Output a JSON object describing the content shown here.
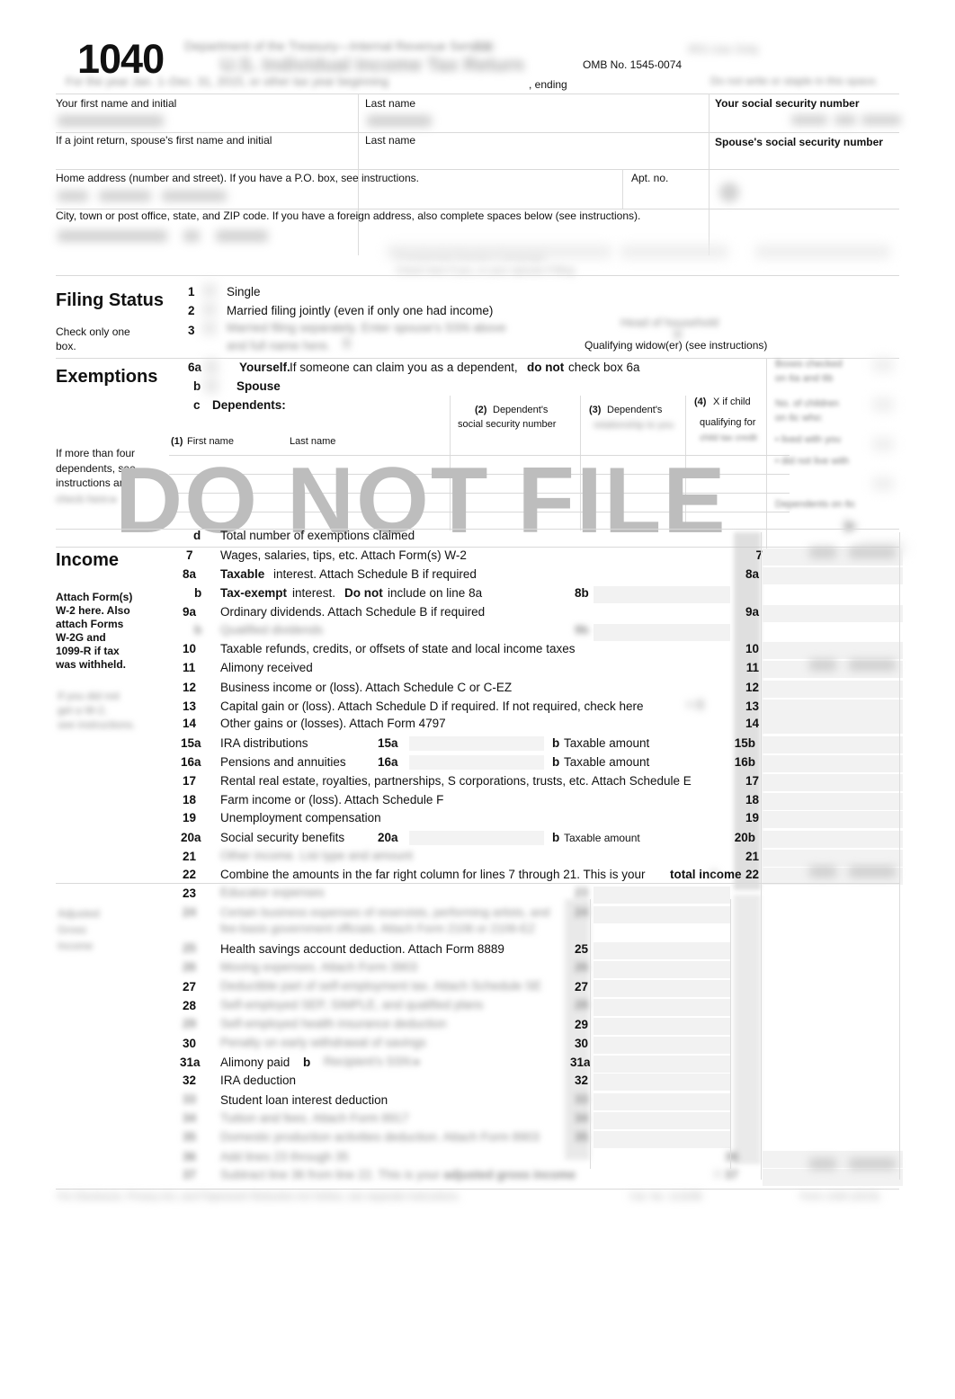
{
  "document": {
    "form_number": "1040",
    "omb": "OMB No. 1545-0074",
    "ending_label": ", ending",
    "watermark": "DO NOT FILE"
  },
  "name_block": {
    "your_first_name": "Your first name and initial",
    "last_name": "Last name",
    "joint_spouse_name": "If a joint return, spouse's first name and initial",
    "spouse_last_name": "Last name",
    "your_ssn": "Your social security number",
    "spouse_ssn": "Spouse's social security number",
    "home_address": "Home address (number and street). If you have a P.O. box, see instructions.",
    "apt_no": "Apt. no.",
    "city_state_zip": "City, town or post office, state, and ZIP code. If you have a foreign address, also complete spaces below (see instructions)."
  },
  "filing_status": {
    "heading": "Filing Status",
    "subtext_line1": "Check only one",
    "subtext_line2": "box.",
    "options": [
      {
        "num": "1",
        "label": "Single"
      },
      {
        "num": "2",
        "label": "Married filing jointly (even if only one had income)"
      },
      {
        "num": "3",
        "label": ""
      }
    ],
    "qualifying_widow": "Qualifying widow(er) (see instructions)"
  },
  "exemptions": {
    "heading": "Exemptions",
    "line_6a_num": "6a",
    "line_6a_bold": "Yourself.",
    "line_6a_text_1": "If someone can claim you as a dependent,",
    "line_6a_bold_2": "do not",
    "line_6a_text_2": "check box 6a",
    "line_b_num": "b",
    "line_b_label": "Spouse",
    "line_c_num": "c",
    "line_c_label": "Dependents:",
    "col1_num": "(1)",
    "col1_first": "First name",
    "col1_last": "Last name",
    "col2_num": "(2)",
    "col2_line1": "Dependent's",
    "col2_line2": "social security number",
    "col3_num": "(3)",
    "col3_line1": "Dependent's",
    "col4_num": "(4)",
    "col4_line1": "X if child",
    "col4_line2": "qualifying for",
    "sidebar_line1": "If more than four",
    "sidebar_line2": "dependents, see",
    "sidebar_line3": "instructions and",
    "line_d_num": "d",
    "line_d_label": "Total number of exemptions claimed"
  },
  "income": {
    "heading": "Income",
    "attach_line1": "Attach Form(s)",
    "attach_line2": "W-2 here. Also",
    "attach_line3": "attach Forms",
    "attach_line4": "W-2G and",
    "attach_line5": "1099-R if tax",
    "attach_line6": "was withheld.",
    "lines": [
      {
        "num": "7",
        "text": "Wages, salaries, tips, etc. Attach Form(s) W-2",
        "amt_label": "7"
      },
      {
        "num": "8a",
        "bold_lead": "Taxable",
        "text": "interest. Attach Schedule B if required",
        "amt_label": "8a"
      },
      {
        "num": "b",
        "bold_lead": "Tax-exempt",
        "text": "interest.",
        "bold_mid": "Do not",
        "text2": "include on line 8a",
        "mid_label": "8b"
      },
      {
        "num": "9a",
        "text": "Ordinary dividends. Attach Schedule B if required",
        "amt_label": "9a"
      },
      {
        "num": "10",
        "text": "Taxable refunds, credits, or offsets of state and local income taxes",
        "amt_label": "10"
      },
      {
        "num": "11",
        "text": "Alimony received",
        "amt_label": "11"
      },
      {
        "num": "12",
        "text": "Business income or (loss). Attach Schedule C or C-EZ",
        "amt_label": "12"
      },
      {
        "num": "13",
        "text": "Capital gain or (loss). Attach Schedule D if required. If not required, check here",
        "amt_label": "13"
      },
      {
        "num": "14",
        "text": "Other gains or (losses). Attach Form 4797",
        "amt_label": "14"
      },
      {
        "num": "15a",
        "text": "IRA distributions",
        "mid_label": "15a",
        "sub_b": "b",
        "sub_text": "Taxable amount",
        "amt_label": "15b"
      },
      {
        "num": "16a",
        "text": "Pensions and annuities",
        "mid_label": "16a",
        "sub_b": "b",
        "sub_text": "Taxable amount",
        "amt_label": "16b"
      },
      {
        "num": "17",
        "text": "Rental real estate, royalties, partnerships, S corporations, trusts, etc. Attach Schedule E",
        "amt_label": "17"
      },
      {
        "num": "18",
        "text": "Farm income or (loss). Attach Schedule F",
        "amt_label": "18"
      },
      {
        "num": "19",
        "text": "Unemployment compensation",
        "amt_label": "19"
      },
      {
        "num": "20a",
        "text": "Social security benefits",
        "mid_label": "20a",
        "sub_b": "b",
        "sub_text": "Taxable amount",
        "amt_label": "20b"
      },
      {
        "num": "21",
        "text": "",
        "amt_label": "21"
      },
      {
        "num": "22",
        "text": "Combine the amounts in the far right column for lines 7 through 21. This is your",
        "bold_tail": "total income",
        "amt_label": "22"
      },
      {
        "num": "23",
        "text": "",
        "amt_label": ""
      }
    ]
  },
  "adjusted": {
    "lines": [
      {
        "num": "",
        "text": "Health savings account deduction. Attach Form 8889",
        "amt_label": "25"
      },
      {
        "num": "27",
        "text": "",
        "amt_label": "27"
      },
      {
        "num": "28",
        "text": "",
        "amt_label": ""
      },
      {
        "num": "",
        "text": "",
        "amt_label": "29"
      },
      {
        "num": "30",
        "text": "",
        "amt_label": "30"
      },
      {
        "num": "31a",
        "text": "Alimony paid",
        "bold_mid": "b",
        "amt_label": "31a"
      },
      {
        "num": "32",
        "text": "IRA deduction",
        "amt_label": "32"
      },
      {
        "num": "",
        "text": "Student loan interest deduction",
        "amt_label": ""
      }
    ]
  }
}
